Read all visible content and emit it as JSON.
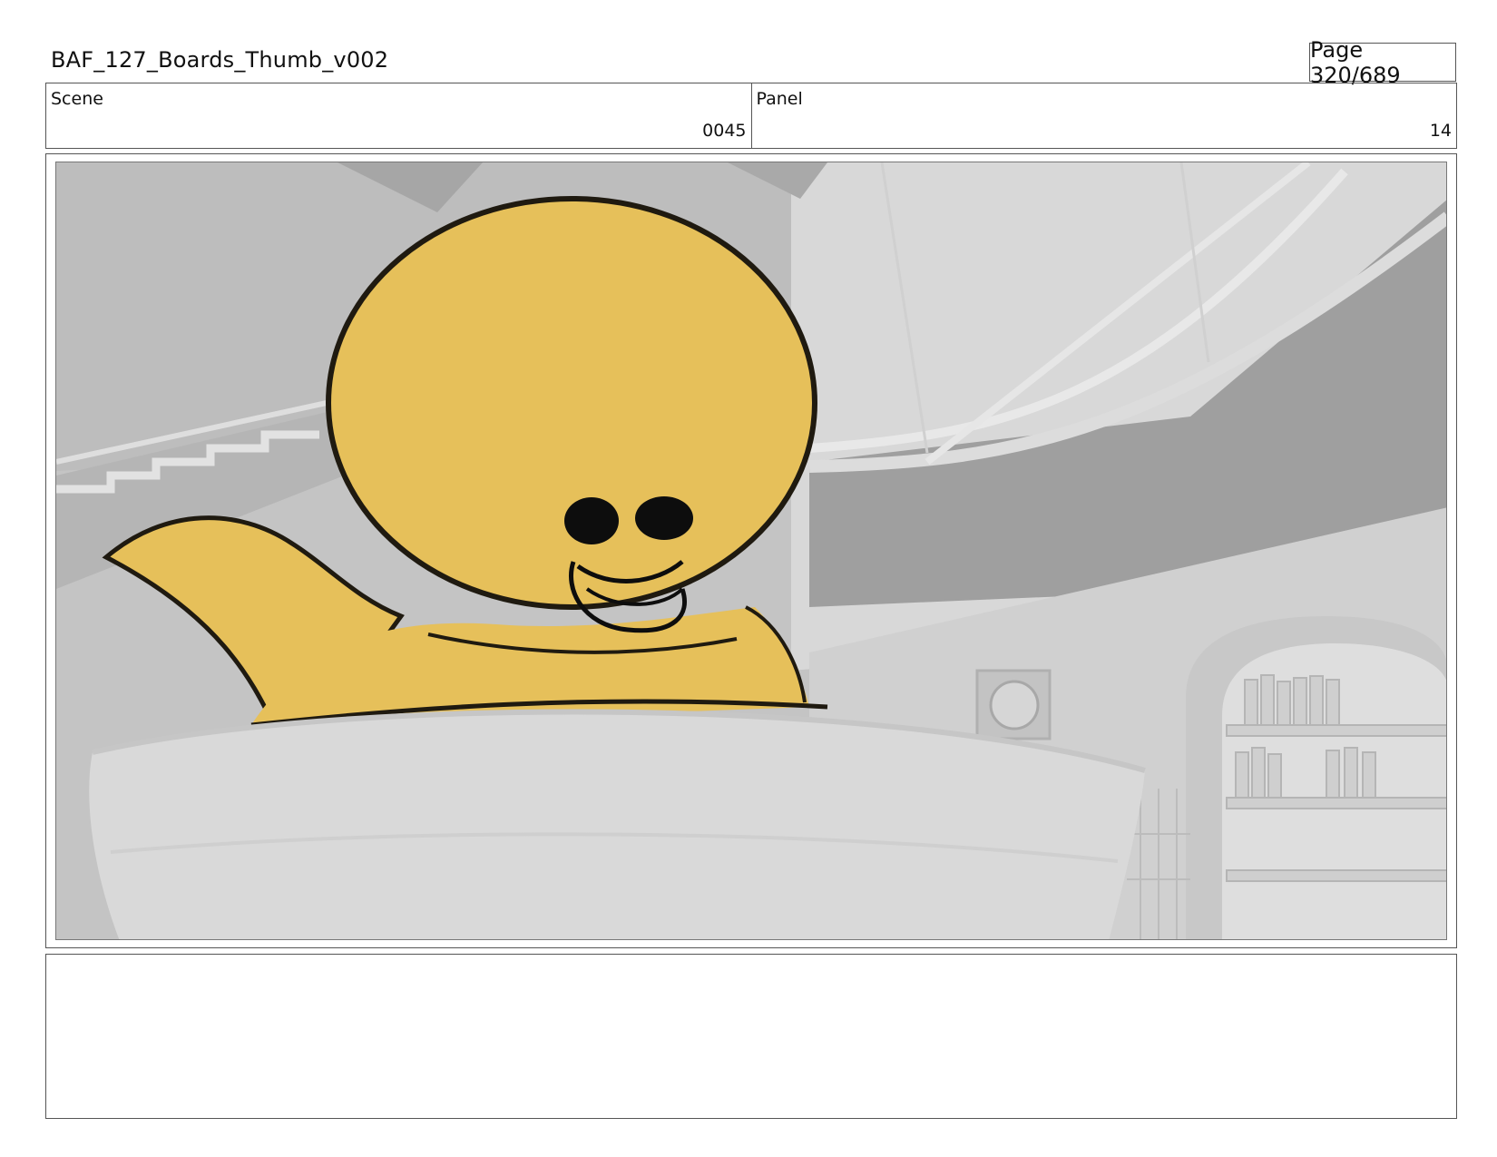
{
  "header": {
    "title": "BAF_127_Boards_Thumb_v002",
    "page": "Page 320/689"
  },
  "scene": {
    "label": "Scene",
    "value": "0045"
  },
  "panel": {
    "label": "Panel",
    "value": "14"
  },
  "notes": {
    "text": ""
  }
}
